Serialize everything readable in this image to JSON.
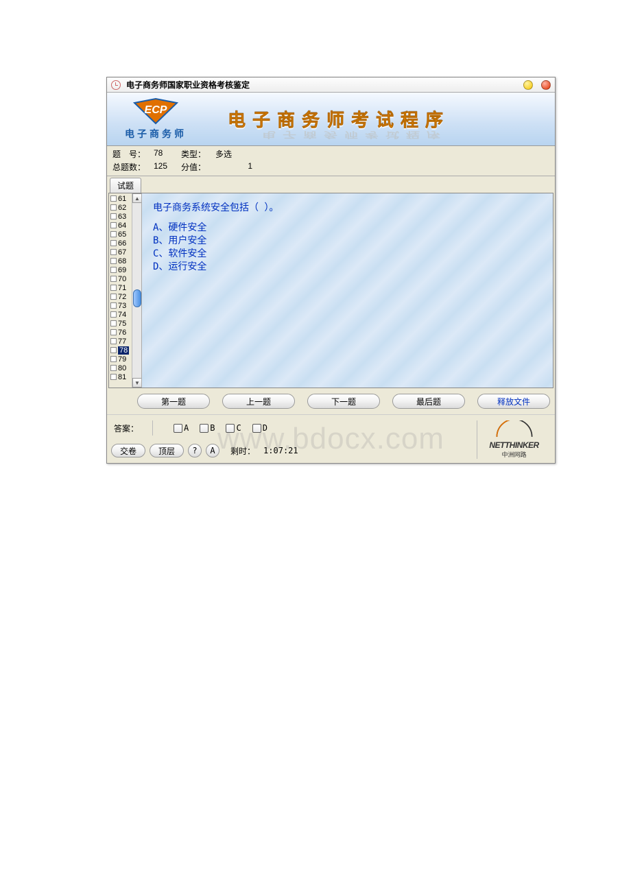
{
  "titlebar": {
    "title": "电子商务师国家职业资格考核鉴定"
  },
  "banner": {
    "logo_sub": "电子商务师",
    "title": "电子商务师考试程序"
  },
  "info": {
    "q_no_label": "题　号：",
    "q_no": "78",
    "type_label": "类型：",
    "type": "多选",
    "total_label": "总题数：",
    "total": "125",
    "score_label": "分值：",
    "score": "1"
  },
  "tab": {
    "label": "试题"
  },
  "qlist": {
    "items": [
      "61",
      "62",
      "63",
      "64",
      "65",
      "66",
      "67",
      "68",
      "69",
      "70",
      "71",
      "72",
      "73",
      "74",
      "75",
      "76",
      "77",
      "78",
      "79",
      "80",
      "81"
    ],
    "selected": "78"
  },
  "question": {
    "text": "电子商务系统安全包括（ ）。",
    "options": [
      "A、硬件安全",
      "B、用户安全",
      "C、软件安全",
      "D、运行安全"
    ]
  },
  "nav": {
    "first": "第一题",
    "prev": "上一题",
    "next": "下一题",
    "last": "最后题",
    "release": "释放文件"
  },
  "answer": {
    "label": "答案：",
    "choices": [
      "A",
      "B",
      "C",
      "D"
    ]
  },
  "footer": {
    "submit": "交卷",
    "top": "顶层",
    "help": "?",
    "a": "A",
    "timer_label": "剩时：",
    "timer": "1:07:21"
  },
  "brand": {
    "name": "NETTHINKER",
    "sub": "中洲网路"
  },
  "watermark": "www.bdocx.com"
}
